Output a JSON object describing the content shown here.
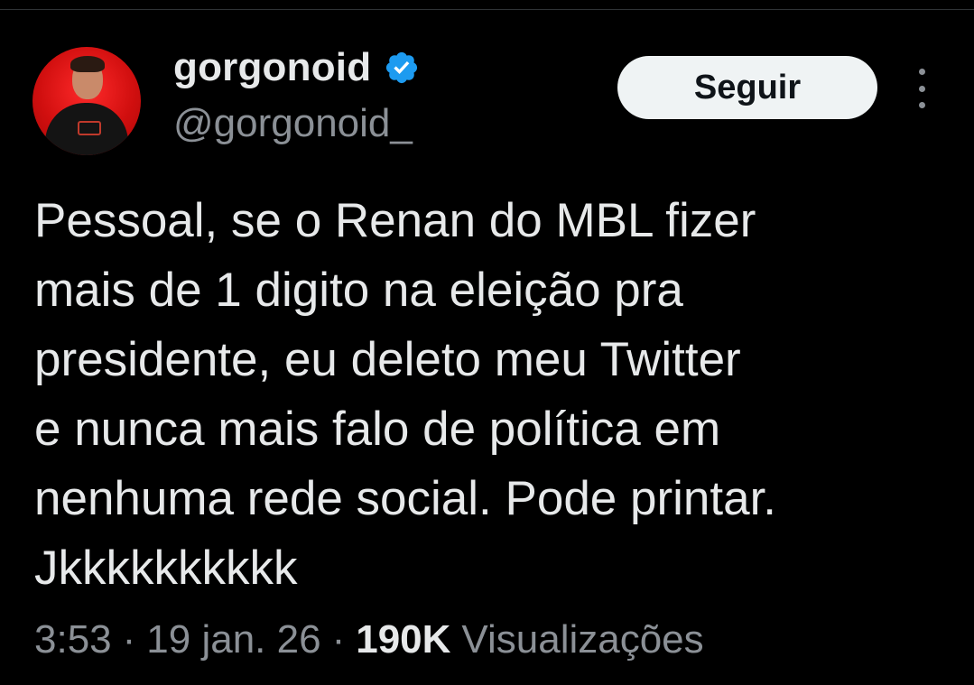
{
  "tweet": {
    "author": {
      "display_name": "gorgonoid",
      "handle": "@gorgonoid_",
      "verified_icon": "verified-badge-icon",
      "verified_color": "#1d9bf0",
      "avatar_background": "#d10f0f"
    },
    "follow_button_label": "Seguir",
    "more_icon": "more-vertical-icon",
    "text": "Pessoal, se o Renan do MBL fizer\nmais de 1 digito na eleição pra\npresidente, eu deleto meu Twitter\ne nunca mais falo de política em\nnenhuma rede social. Pode printar.\nJkkkkkkkkkk",
    "time": "3:53",
    "separator": "·",
    "date": "19 jan. 26",
    "views_count": "190K",
    "views_label": "Visualizações"
  },
  "colors": {
    "background": "#000000",
    "primary_text": "#e7e9ea",
    "secondary_text": "#8b9096",
    "follow_button_bg": "#eff3f4"
  }
}
